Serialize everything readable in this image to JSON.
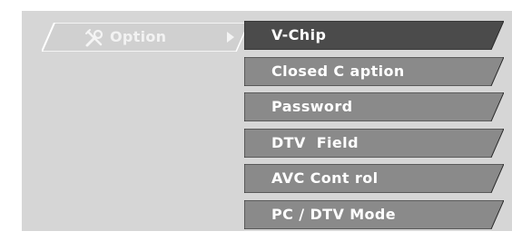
{
  "tab": {
    "label": "Option",
    "icon": "tool-icon",
    "arrow": "arrow-right-icon"
  },
  "menu": {
    "items": [
      {
        "label": "V-Chip",
        "selected": true
      },
      {
        "label": "Closed C aption",
        "selected": false
      },
      {
        "label": "Password",
        "selected": false
      },
      {
        "label": "DTV  Field",
        "selected": false
      },
      {
        "label": "AVC Cont rol",
        "selected": false
      },
      {
        "label": "PC / DTV Mode",
        "selected": false
      }
    ]
  },
  "colors": {
    "background": "#d6d6d6",
    "tab_fill": "#d0d0d0",
    "item_selected": "#4b4b4b",
    "item_normal": "#8a8a8a",
    "item_border": "#2a2a2a"
  }
}
